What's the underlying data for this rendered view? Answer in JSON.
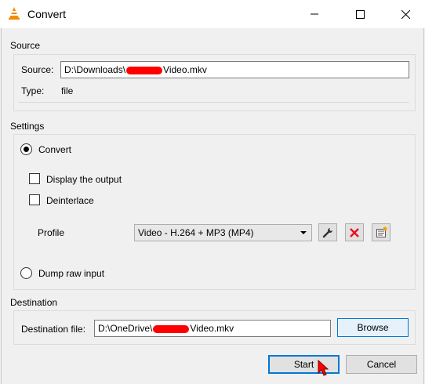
{
  "window": {
    "title": "Convert",
    "minimize_icon": "minimize-icon",
    "maximize_icon": "maximize-icon",
    "close_icon": "close-icon"
  },
  "source": {
    "group_title": "Source",
    "source_label": "Source:",
    "source_path_prefix": "D:\\Downloads\\",
    "source_path_suffix": "Video.mkv",
    "type_label": "Type:",
    "type_value": "file"
  },
  "settings": {
    "group_title": "Settings",
    "convert_label": "Convert",
    "display_output_label": "Display the output",
    "deinterlace_label": "Deinterlace",
    "profile_label": "Profile",
    "profile_selected": "Video - H.264 + MP3 (MP4)",
    "dump_raw_label": "Dump raw input"
  },
  "destination": {
    "group_title": "Destination",
    "file_label": "Destination file:",
    "file_path_prefix": "D:\\OneDrive\\",
    "file_path_suffix": "Video.mkv",
    "browse_label": "Browse"
  },
  "actions": {
    "start_label": "Start",
    "cancel_label": "Cancel"
  },
  "colors": {
    "accent": "#0078d7",
    "redaction": "#ff0000",
    "delete_icon": "#e81123"
  }
}
